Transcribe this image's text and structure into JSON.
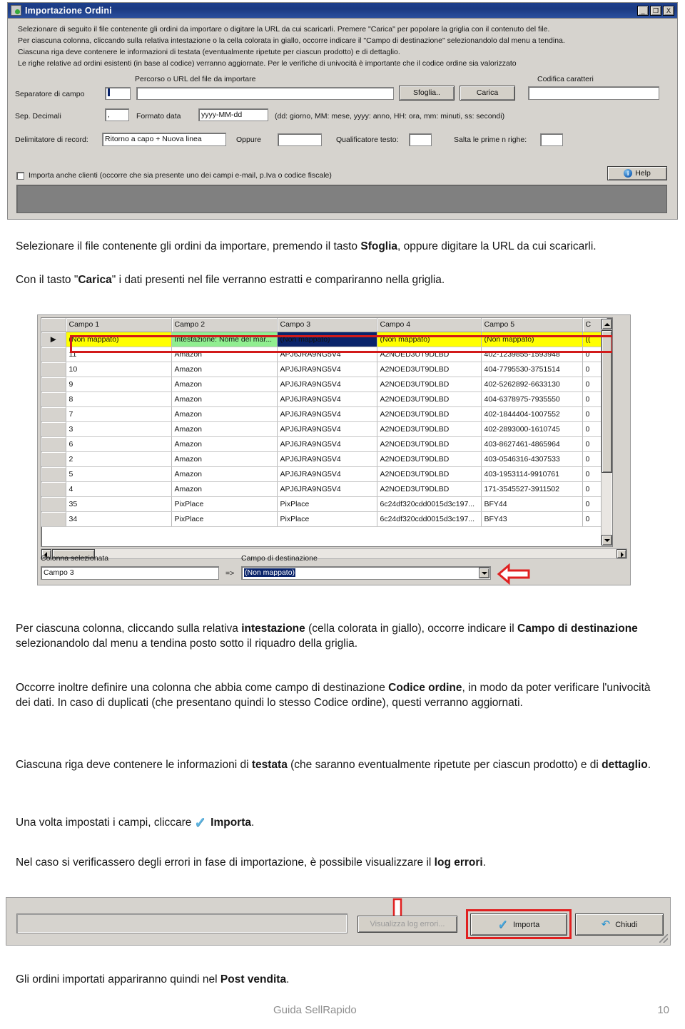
{
  "dialog": {
    "title": "Importazione Ordini",
    "window_buttons": {
      "minimize": "_",
      "maximize": "❐",
      "close": "X"
    },
    "instructions": [
      "Selezionare di seguito il file contenente gli ordini da importare o digitare la URL da cui scaricarli. Premere \"Carica\" per popolare la griglia con il contenuto del file.",
      "Per ciascuna colonna, cliccando sulla relativa intestazione o la cella colorata in giallo, occorre indicare il \"Campo di destinazione\" selezionandolo dal menu a tendina.",
      "Ciascuna riga deve contenere le informazioni di testata (eventualmente ripetute per ciascun prodotto) e di dettaglio.",
      "Le righe relative ad ordini esistenti (in base al codice) verranno aggiornate. Per le verifiche di univocità è importante che il codice ordine sia valorizzato"
    ],
    "labels": {
      "path_url": "Percorso o URL del file da importare",
      "encoding": "Codifica caratteri",
      "field_separator": "Separatore di campo",
      "decimal_separator": "Sep. Decimali",
      "date_format": "Formato data",
      "date_hint": "(dd: giorno, MM: mese, yyyy: anno, HH: ora, mm: minuti, ss: secondi)",
      "record_delimiter": "Delimitatore di record:",
      "or": "Oppure",
      "text_qualifier": "Qualificatore testo:",
      "skip_rows": "Salta le prime n righe:",
      "import_customers": "Importa anche clienti (occorre che sia presente uno dei campi e-mail, p.Iva o codice fiscale)"
    },
    "values": {
      "field_separator": "|",
      "path_url": "",
      "encoding": "",
      "decimal_separator": ",",
      "date_format": "yyyy-MM-dd",
      "record_delimiter": "Ritorno a capo + Nuova linea",
      "or_value": "",
      "text_qualifier": "",
      "skip_rows": ""
    },
    "buttons": {
      "browse": "Sfoglia..",
      "load": "Carica",
      "help": "Help"
    }
  },
  "grid_shot": {
    "columns": [
      "Campo 1",
      "Campo 2",
      "Campo 3",
      "Campo 4",
      "Campo 5",
      "C"
    ],
    "mapping_row": [
      "(Non mappato)",
      "Intestazione: Nome del mar...",
      "(Non mappato)",
      "(Non mappato)",
      "(Non mappato)",
      "(("
    ],
    "mapping_colors": [
      "#ffff00",
      "#90ee90",
      "#0a246a",
      "#ffff00",
      "#ffff00",
      "#ffff00"
    ],
    "rows": [
      [
        "11",
        "Amazon",
        "APJ6JRA9NG5V4",
        "A2NOED3UT9DLBD",
        "402-1239855-1593948",
        "0"
      ],
      [
        "10",
        "Amazon",
        "APJ6JRA9NG5V4",
        "A2NOED3UT9DLBD",
        "404-7795530-3751514",
        "0"
      ],
      [
        "9",
        "Amazon",
        "APJ6JRA9NG5V4",
        "A2NOED3UT9DLBD",
        "402-5262892-6633130",
        "0"
      ],
      [
        "8",
        "Amazon",
        "APJ6JRA9NG5V4",
        "A2NOED3UT9DLBD",
        "404-6378975-7935550",
        "0"
      ],
      [
        "7",
        "Amazon",
        "APJ6JRA9NG5V4",
        "A2NOED3UT9DLBD",
        "402-1844404-1007552",
        "0"
      ],
      [
        "3",
        "Amazon",
        "APJ6JRA9NG5V4",
        "A2NOED3UT9DLBD",
        "402-2893000-1610745",
        "0"
      ],
      [
        "6",
        "Amazon",
        "APJ6JRA9NG5V4",
        "A2NOED3UT9DLBD",
        "403-8627461-4865964",
        "0"
      ],
      [
        "2",
        "Amazon",
        "APJ6JRA9NG5V4",
        "A2NOED3UT9DLBD",
        "403-0546316-4307533",
        "0"
      ],
      [
        "5",
        "Amazon",
        "APJ6JRA9NG5V4",
        "A2NOED3UT9DLBD",
        "403-1953114-9910761",
        "0"
      ],
      [
        "4",
        "Amazon",
        "APJ6JRA9NG5V4",
        "A2NOED3UT9DLBD",
        "171-3545527-3911502",
        "0"
      ],
      [
        "35",
        "PixPlace",
        "PixPlace",
        "6c24df320cdd0015d3c197...",
        "BFY44",
        "0"
      ],
      [
        "34",
        "PixPlace",
        "PixPlace",
        "6c24df320cdd0015d3c197...",
        "BFY43",
        "0"
      ]
    ],
    "selected_column_label": "Colonna selezionata",
    "selected_column_value": "Campo 3",
    "arrow_symbol": "=>",
    "dest_field_label": "Campo di destinazione",
    "dest_field_value": "(Non mappato)"
  },
  "copy": {
    "p1_a": "Selezionare il file contenente gli ordini da importare, premendo il tasto ",
    "p1_b": "Sfoglia",
    "p1_c": ", oppure digitare la URL da cui scaricarli.",
    "p2_a": "Con il tasto \"",
    "p2_b": "Carica",
    "p2_c": "\" i dati presenti nel file verranno estratti e compariranno nella griglia.",
    "p3_a": "Per ciascuna colonna, cliccando sulla relativa ",
    "p3_b": "intestazione",
    "p3_c": " (cella colorata in giallo), occorre indicare il ",
    "p3_d": "Campo di destinazione",
    "p3_e": " selezionandolo dal menu a tendina posto sotto il riquadro della griglia.",
    "p4_a": "Occorre inoltre definire una colonna che abbia come campo di destinazione ",
    "p4_b": "Codice ordine",
    "p4_c": ", in modo da poter verificare l'univocità dei dati. In caso di duplicati (che presentano quindi lo stesso Codice ordine), questi verranno aggiornati.",
    "p5_a": "Ciascuna riga deve contenere le informazioni di ",
    "p5_b": "testata",
    "p5_c": " (che saranno eventualmente ripetute per ciascun prodotto) e di ",
    "p5_d": "dettaglio",
    "p5_e": ".",
    "p6_a": "Una volta impostati i campi, cliccare",
    "p6_b": "Importa",
    "p6_c": ".",
    "p7_a": "Nel caso si verificassero degli errori in fase di importazione, è possibile visualizzare il ",
    "p7_b": "log errori",
    "p7_c": ".",
    "p8_a": "Gli ordini importati appariranno quindi nel ",
    "p8_b": "Post vendita",
    "p8_c": "."
  },
  "toolbar_shot": {
    "status_value": "",
    "view_log_button": "Visualizza log errori...",
    "import_button": "Importa",
    "close_button": "Chiudi"
  },
  "footer": {
    "guide": "Guida SellRapido",
    "page": "10"
  },
  "colors": {
    "titlebar": "#1b3a82",
    "window_face": "#d6d3ce",
    "highlight_yellow": "#ffff00",
    "mapped_green": "#90ee90",
    "selected_navy": "#0a246a",
    "annotation_red": "#d21a1a",
    "accent_blue": "#4aa8dd"
  }
}
